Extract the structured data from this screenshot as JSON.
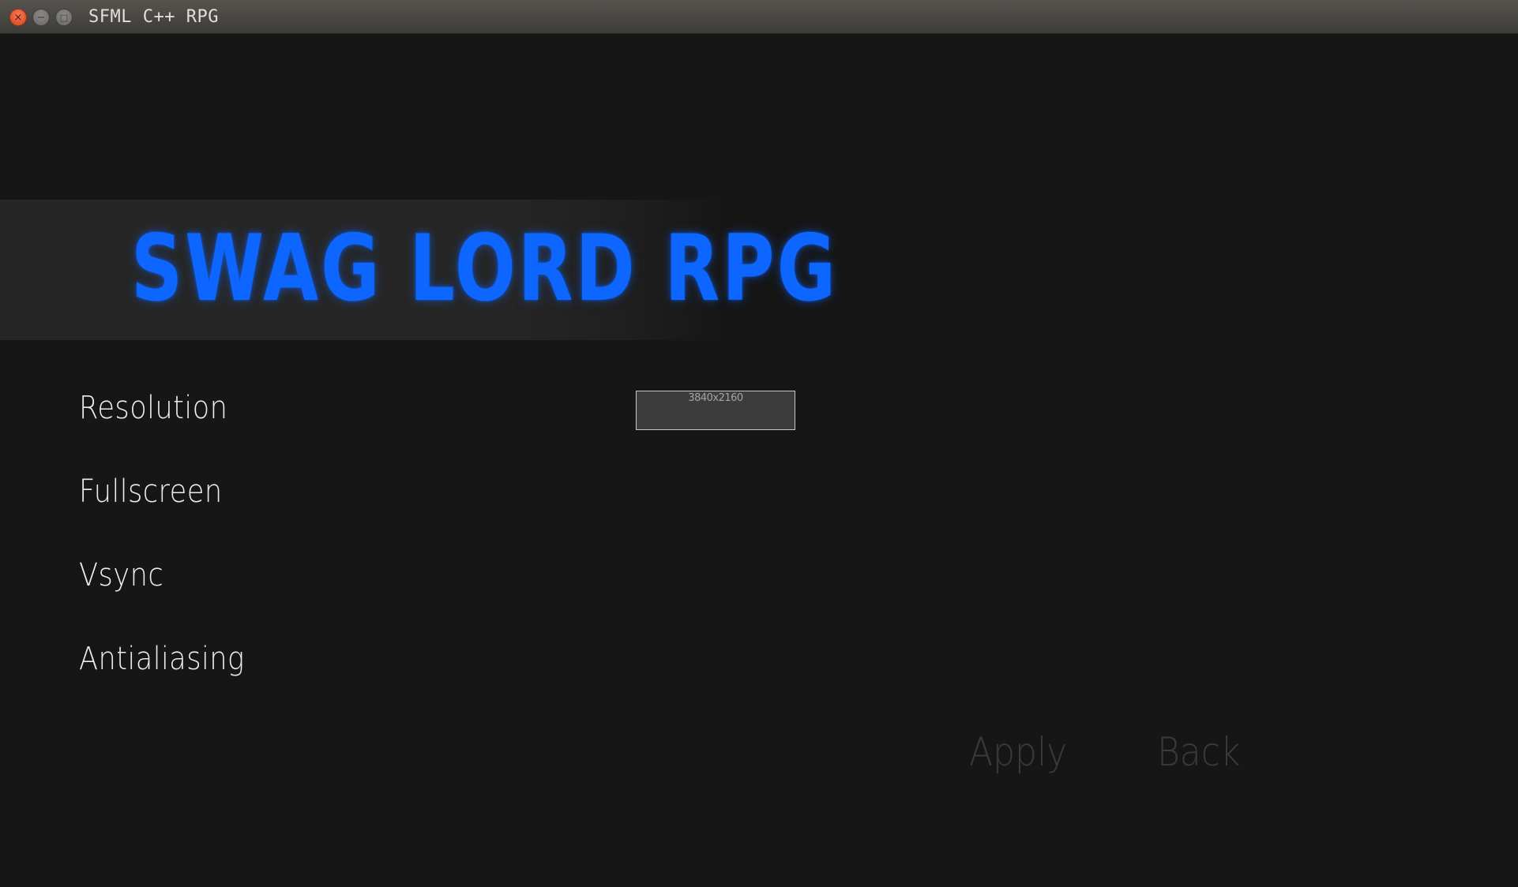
{
  "window": {
    "title": "SFML C++ RPG",
    "controls": {
      "close_glyph": "×",
      "minimize_glyph": "−",
      "maximize_glyph": "□"
    }
  },
  "logo": {
    "text": "SWAG LORD RPG",
    "color": "#0d66ff"
  },
  "settings": {
    "resolution_label": "Resolution",
    "fullscreen_label": "Fullscreen",
    "vsync_label": "Vsync",
    "antialiasing_label": "Antialiasing",
    "resolution_dropdown": {
      "selected": "3840x2160"
    }
  },
  "actions": {
    "apply_label": "Apply",
    "back_label": "Back"
  }
}
